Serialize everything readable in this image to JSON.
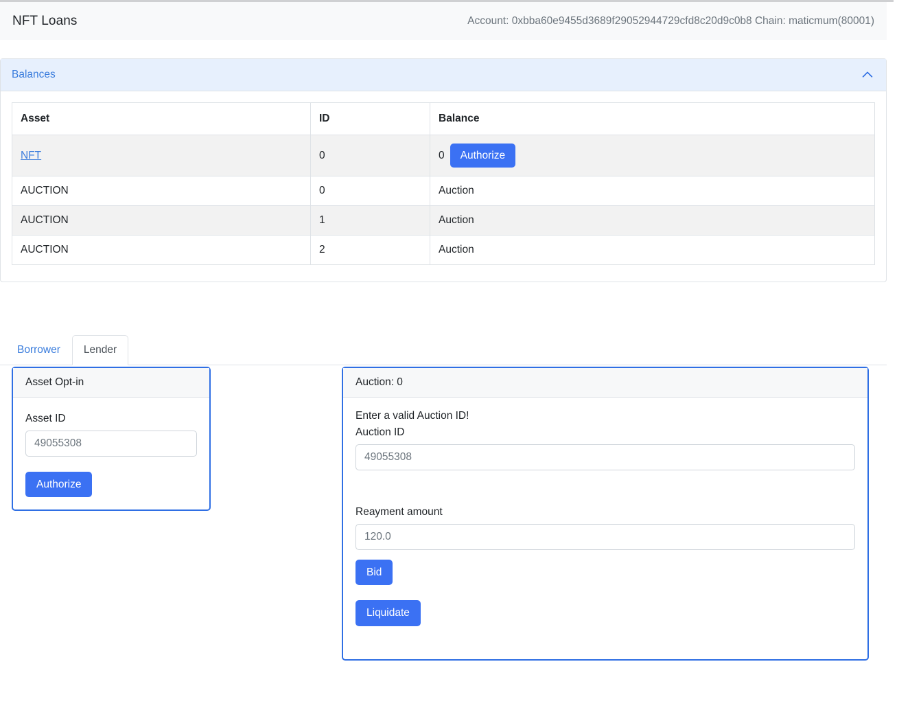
{
  "navbar": {
    "brand": "NFT Loans",
    "account_info": "Account: 0xbba60e9455d3689f29052944729cfd8c20d9c0b8 Chain: maticmum(80001)"
  },
  "balances_panel": {
    "title": "Balances",
    "toggle_icon": "chevron-up-icon",
    "columns": [
      "Asset",
      "ID",
      "Balance"
    ],
    "rows": [
      {
        "asset": "NFT",
        "asset_is_link": true,
        "id": "0",
        "balance": "0",
        "action_label": "Authorize"
      },
      {
        "asset": "AUCTION",
        "asset_is_link": false,
        "id": "0",
        "balance": "Auction",
        "action_label": null
      },
      {
        "asset": "AUCTION",
        "asset_is_link": false,
        "id": "1",
        "balance": "Auction",
        "action_label": null
      },
      {
        "asset": "AUCTION",
        "asset_is_link": false,
        "id": "2",
        "balance": "Auction",
        "action_label": null
      }
    ]
  },
  "tabs": {
    "items": [
      {
        "label": "Borrower",
        "active": false
      },
      {
        "label": "Lender",
        "active": true
      }
    ]
  },
  "optin_card": {
    "header": "Asset Opt-in",
    "asset_id_label": "Asset ID",
    "asset_id_placeholder": "49055308",
    "asset_id_value": "",
    "authorize_label": "Authorize"
  },
  "auction_card": {
    "header": "Auction: 0",
    "validation_message": "Enter a valid Auction ID!",
    "auction_id_label": "Auction ID",
    "auction_id_placeholder": "49055308",
    "auction_id_value": "",
    "repayment_label": "Reayment amount",
    "repayment_placeholder": "120.0",
    "repayment_value": "",
    "bid_label": "Bid",
    "liquidate_label": "Liquidate"
  },
  "colors": {
    "primary_button": "#3b71f3",
    "link": "#3b7ddd",
    "panel_header_bg": "#e7f0fd",
    "card_border": "#2f6fe4",
    "navbar_bg": "#f8f9fa",
    "striped_row_bg": "#f2f2f2"
  }
}
